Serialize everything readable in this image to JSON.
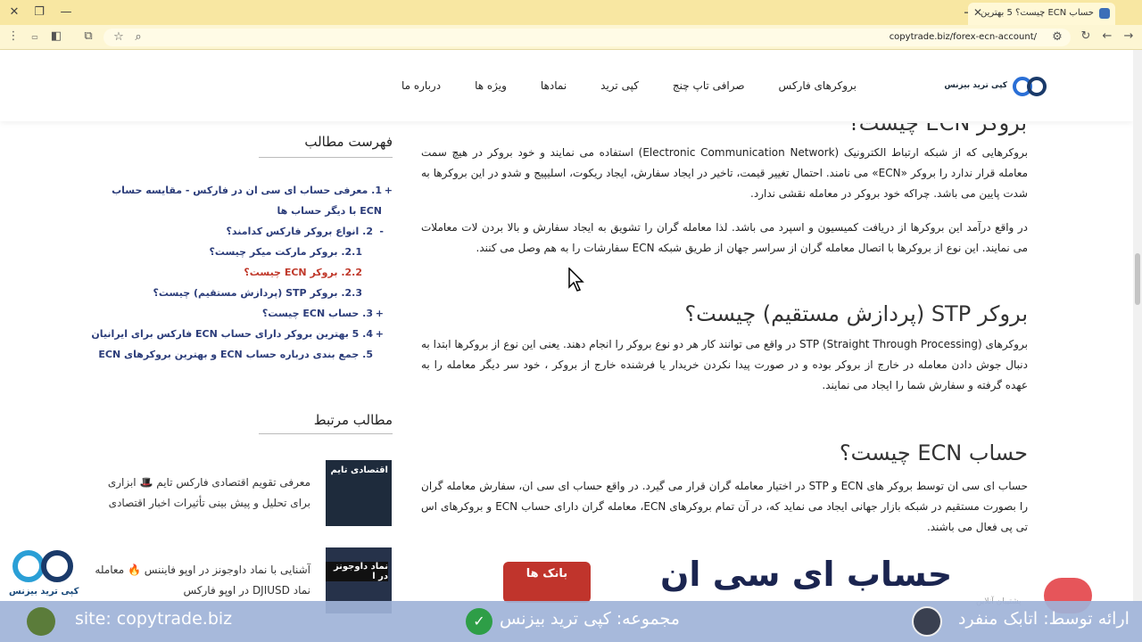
{
  "browser": {
    "tab_title": "حساب ECN چیست؟ 5 بهترین",
    "url": "copytrade.biz/forex-ecn-account/"
  },
  "header": {
    "logo_text": "کپی ترید بیزنس",
    "nav": [
      "بروکرهای فارکس",
      "صرافی تاپ چنج",
      "کپی ترید",
      "نمادها",
      "ویژه ها",
      "درباره ما"
    ]
  },
  "article": {
    "partial_heading": "بروکر ECN چیست؟",
    "p1": "بروکرهایی که از شبکه ارتباط الکترونیک (Electronic Communication Network) استفاده می نمایند و خود بروکر در هیچ سمت معامله قرار ندارد را بروکر «ECN» می نامند.  احتمال تغییر قیمت، تاخیر در ایجاد سفارش، ایجاد ریکوت، اسلیپیج و شدو در این بروکرها به شدت پایین می باشد. چراکه خود بروکر در معامله نقشی ندارد.",
    "p2": "در واقع درآمد این بروکرها از دریافت کمیسیون و اسپرد می باشد. لذا معامله گران را تشویق به ایجاد سفارش و بالا بردن لات معاملات می نمایند. این نوع از بروکرها با اتصال معامله گران از سراسر جهان از طریق شبکه ECN سفارشات را به هم وصل می کنند.",
    "h_stp": "بروکر STP (پردازش مستقیم) چیست؟",
    "p3": "بروکرهای STP (Straight Through Processing) در واقع می توانند کار هر دو نوع بروکر را انجام دهند. یعنی این نوع از بروکرها ابتدا به دنبال جوش دادن معامله در خارج از بروکر بوده و در صورت  پیدا نکردن خریدار یا فرشنده خارج از بروکر ، خود سر دیگر معامله را به عهده گرفته و سفارش شما را ایجاد می نمایند.",
    "h_ecn": "حساب ECN چیست؟",
    "p4": "حساب ای سی ان توسط بروکر های ECN و STP در اختیار معامله گران قرار می گیرد. در واقع حساب ای سی ان، سفارش معامله گران را بصورت مستقیم در شبکه بازار جهانی ایجاد می نماید که، در آن تمام بروکرهای ECN، معامله گران دارای حساب ECN  و بروکرهای اس تی پی  فعال می باشند.",
    "banner_title": "حساب ای سی ان",
    "banner_badge": "بانک ها"
  },
  "sidebar": {
    "toc_title": "فهرست مطالب",
    "toc": [
      {
        "marker": "+",
        "text": "1. معرفی حساب ای سی ان در فارکس - مقایسه حساب ECN با دیگر حساب ها"
      },
      {
        "marker": "-",
        "text": "2. انواع بروکر فارکس کدامند؟"
      },
      {
        "marker": "",
        "text": "2.1. بروکر مارکت میکر چیست؟"
      },
      {
        "marker": "",
        "text": "2.2. بروکر ECN چیست؟"
      },
      {
        "marker": "",
        "text": "2.3. بروکر STP (پردازش مستقیم) چیست؟"
      },
      {
        "marker": "+",
        "text": "3. حساب ECN چیست؟"
      },
      {
        "marker": "+",
        "text": "4. 5 بهترین بروکر دارای حساب ECN فارکس برای ایرانیان"
      },
      {
        "marker": "",
        "text": "5. جمع بندی درباره حساب ECN و بهترین بروکرهای ECN"
      }
    ],
    "related_title": "مطالب مرتبط",
    "related": [
      {
        "text": "معرفی تقویم اقتصادی فارکس تایم 🎩 ابزاری برای تحلیل و پیش بینی تأثیرات اخبار اقتصادی",
        "thumb": "اقتصادی تایم"
      },
      {
        "text": "آشنایی با نماد داوجونز در اوپو فایننس 🔥 معامله نماد DJIUSD در اوپو فارکس",
        "thumb": "نماد داوجونز در ا"
      }
    ]
  },
  "overlay": {
    "site": "site: copytrade.biz",
    "collection": "مجموعه: کپی ترید بیزنس",
    "presenter": "ارائه توسط: اتابک منفرد",
    "corner_logo_text": "کپی ترید بیزنس",
    "chat_hint": "پشتیبان آنلاین"
  },
  "colors": {
    "tabstrip": "#f8e7a2",
    "toc_link": "#2c3d7a",
    "toc_active": "#c0392b",
    "footer_band": "#9fb3d8",
    "brand": "#2a6fd6"
  }
}
